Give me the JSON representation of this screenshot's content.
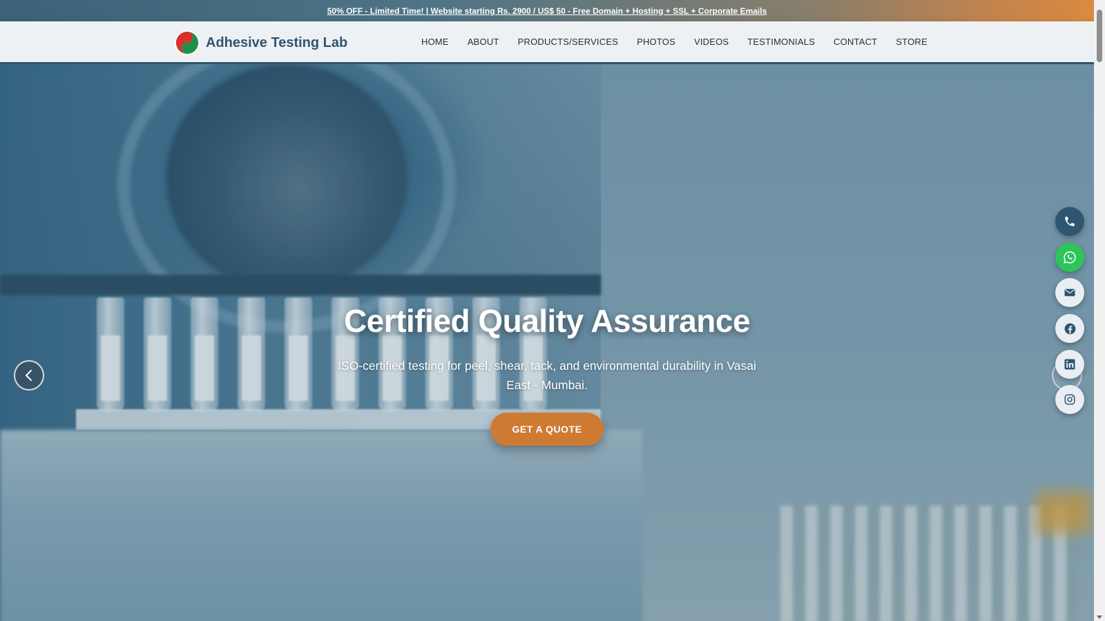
{
  "promo": {
    "text": "50% OFF - Limited Time! | Website starting Rs. 2900 / US$ 50 - Free Domain + Hosting + SSL + Corporate Emails"
  },
  "header": {
    "brand": "Adhesive Testing Lab",
    "nav": [
      "HOME",
      "ABOUT",
      "PRODUCTS/SERVICES",
      "PHOTOS",
      "VIDEOS",
      "TESTIMONIALS",
      "CONTACT",
      "STORE"
    ]
  },
  "hero": {
    "title": "Certified Quality Assurance",
    "subtitle": "ISO-certified testing for peel, shear, tack, and environmental durability in Vasai East - Mumbai.",
    "cta": "GET A QUOTE"
  },
  "floating": {
    "icons": [
      "phone-icon",
      "whatsapp-icon",
      "mail-icon",
      "facebook-icon",
      "linkedin-icon",
      "instagram-icon"
    ]
  },
  "colors": {
    "brand": "#2e5670",
    "accent": "#cf7a33",
    "whatsapp": "#2dc45a"
  }
}
